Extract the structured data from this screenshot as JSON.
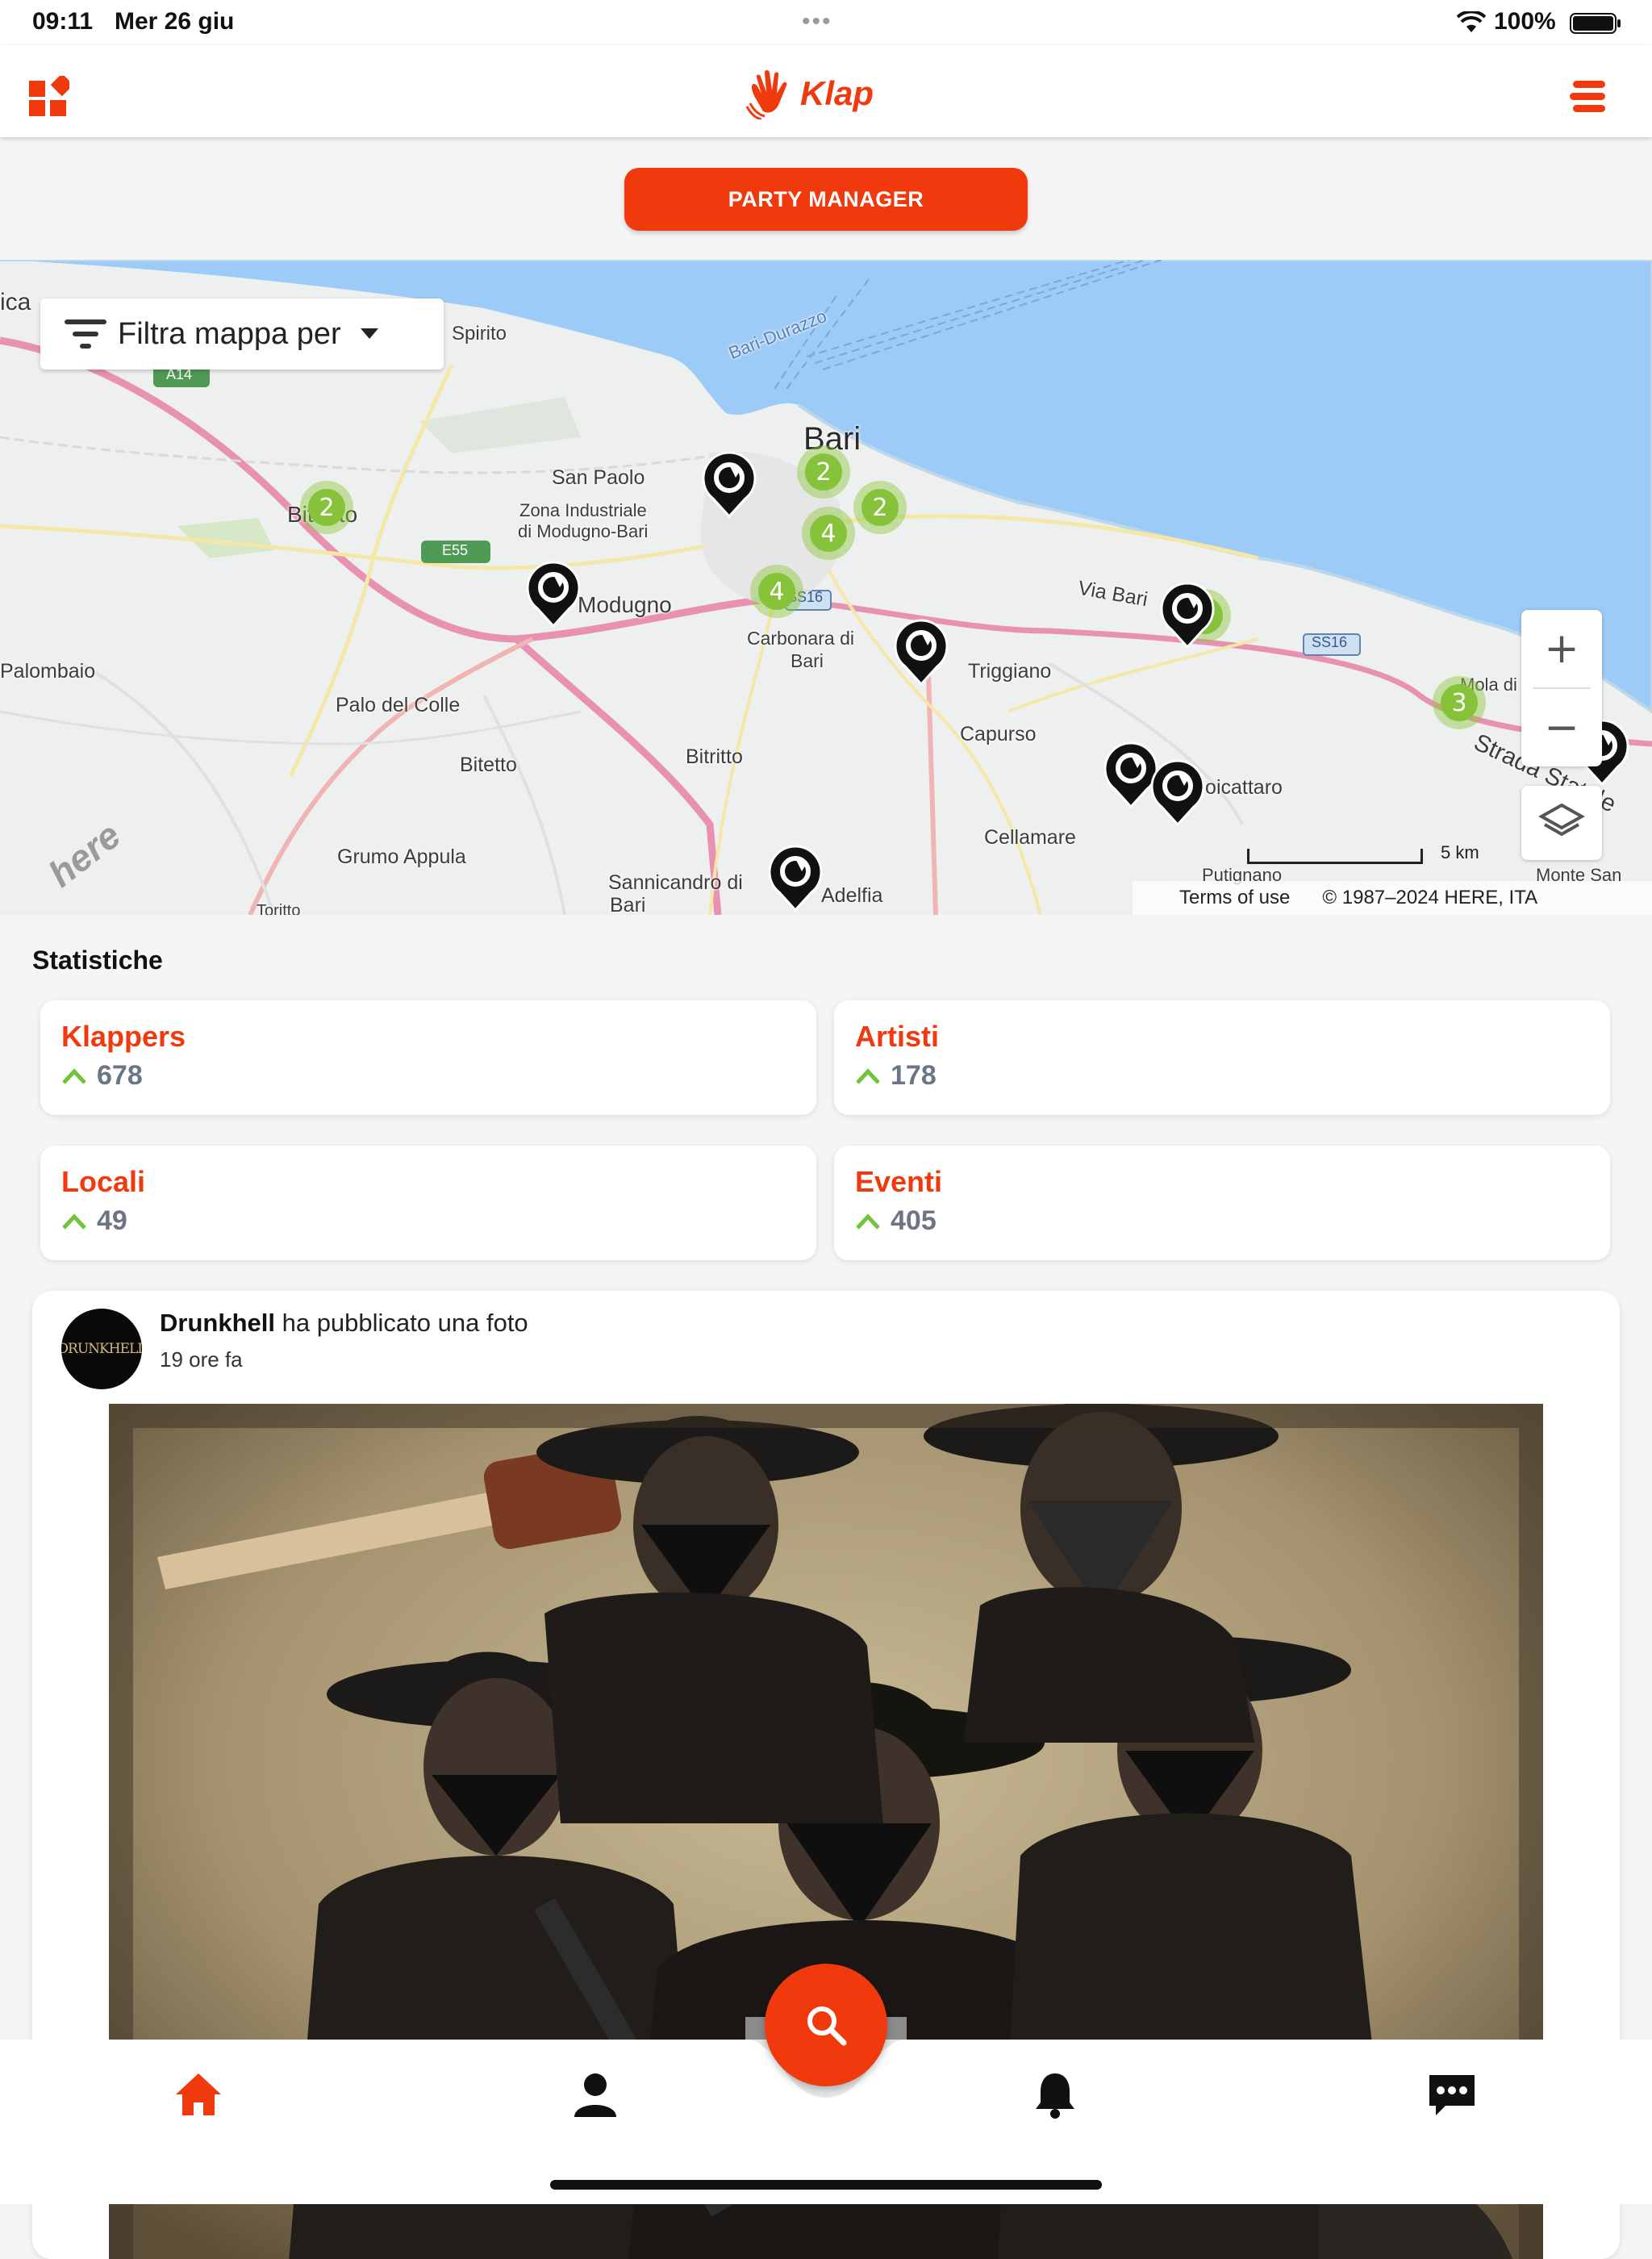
{
  "status_bar": {
    "time": "09:11",
    "date": "Mer 26 giu",
    "dots": "•••",
    "battery": "100%"
  },
  "header": {
    "brand": "Klap",
    "brand_color": "#f03a0e"
  },
  "party_manager": {
    "label": "PARTY MANAGER"
  },
  "map": {
    "filter_label": "Filtra mappa per",
    "zoom_in": "+",
    "zoom_out": "−",
    "scale": "5 km",
    "terms": "Terms of use",
    "copyright": "© 1987–2024 HERE, ITA",
    "provider_logo": "here",
    "places": [
      "Bari",
      "San Paolo",
      "Zona Industriale",
      "di Modugno-Bari",
      "Bitonto",
      "Modugno",
      "Palombaio",
      "Palo del Colle",
      "Bitetto",
      "Grumo Appula",
      "Bitritto",
      "Carbonara di",
      "Bari",
      "Triggiano",
      "Capurso",
      "Cellamare",
      "Noicattaro",
      "Sannicandro di",
      "Bari",
      "Adelfia",
      "Via Bari",
      "Mola di Bari",
      "Strada Statale",
      "Putignano",
      "Monte San",
      "Spirito",
      "Bari-Durazzo",
      "SS16",
      "SS16",
      "A14",
      "E55",
      "Toritto",
      "ica"
    ],
    "clusters": [
      "2",
      "2",
      "2",
      "4",
      "4",
      "3",
      "3"
    ]
  },
  "stats": {
    "title": "Statistiche",
    "items": [
      {
        "label": "Klappers",
        "value": "678"
      },
      {
        "label": "Artisti",
        "value": "178"
      },
      {
        "label": "Locali",
        "value": "49"
      },
      {
        "label": "Eventi",
        "value": "405"
      }
    ]
  },
  "post": {
    "author": "Drunkhell",
    "action": "ha pubblicato una foto",
    "time": "19 ore fa",
    "avatar_text": "DRUNKHELL"
  },
  "nav": {
    "items": [
      "home-icon",
      "profile-icon",
      "search-icon",
      "bell-icon",
      "chat-icon"
    ]
  }
}
